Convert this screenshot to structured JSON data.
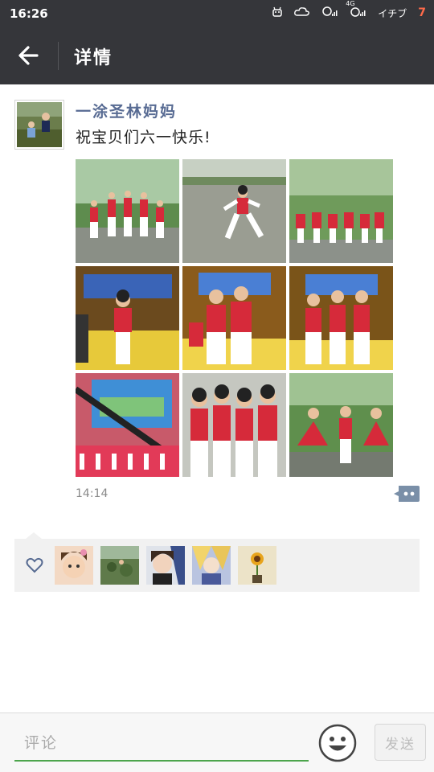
{
  "status_bar": {
    "time": "16:26",
    "network": "4G",
    "carrier": "イチブ",
    "battery": "7"
  },
  "header": {
    "back_icon": "arrow-left-icon",
    "title": "详情"
  },
  "post": {
    "author": "一涂圣林妈妈",
    "text": "祝宝贝们六一快乐!",
    "time": "14:14",
    "photo_count": 9,
    "comment_icon": "comment-dots-icon"
  },
  "likes": {
    "icon": "heart-icon",
    "liker_count": 5
  },
  "comment_bar": {
    "placeholder": "评论",
    "emoji_icon": "smiley-icon",
    "send_label": "发送"
  },
  "colors": {
    "header_bg": "#35363a",
    "name_color": "#586b93",
    "accent_green": "#4ca54c",
    "likes_bg": "#f1f1f1"
  }
}
